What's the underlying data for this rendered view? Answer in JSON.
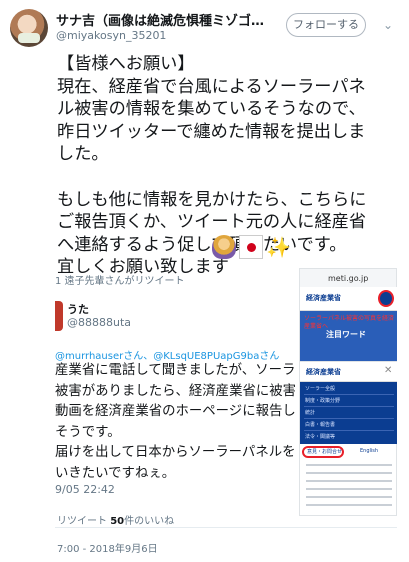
{
  "header": {
    "display_name": "サナ吉（画像は絶滅危惧種ミゾゴイ...",
    "handle": "@miyakosyn_35201",
    "follow_label": "フォローする",
    "caret_icon": "chevron-down-icon"
  },
  "tweet": {
    "text": "【皆様へお願い】\n現在、経産省で台風によるソーラーパネ\nル被害の情報を集めているそうなので、\n昨日ツイッターで纏めた情報を提出しま\nした。\n\nもしも他に情報を見かけたら、こちらに\nご報告頂くか、ツイート元の人に経産省\nへ連絡するよう促して頂きたいです。\n宜しくお願い致します",
    "emojis": [
      "woman-bowing-emoji",
      "japan-flag-emoji",
      "sparkles-emoji"
    ],
    "sparkles_glyph": "✨"
  },
  "quote": {
    "retweet_note": "1 遠子先輩さんがリツイート",
    "name": "うた",
    "handle": "@88888uta",
    "reply_to": "@murrhauserさん、@KLsqUE8PUapG9baさん",
    "body": "産業省に電話して聞きましたが、ソーラー\n被害がありましたら、経済産業省に被害の\n動画を経済産業省のホーページに報告して\nそうです。\n届けを出して日本からソーラーパネルを排\nいきたいですねぇ。",
    "time": "9/05 22:42",
    "phone1": {
      "url": "meti.go.jp",
      "logo": "経済産業省",
      "red_text": "ソーラーパネル被害の写真を経済産業省へ",
      "notice": "注目ワード"
    },
    "phone2": {
      "logo": "経済産業省",
      "close": "✕",
      "menu_items": [
        "ソーラー全般",
        "制度・政策分野",
        "統計",
        "白書・報告書",
        "法令・閣議等"
      ],
      "highlight": "意見・お問合せ",
      "english": "English"
    }
  },
  "footer": {
    "retweets_label": "リツイート",
    "likes_count": "50",
    "likes_label": "件のいいね",
    "timestamp": "7:00 - 2018年9月6日"
  },
  "colors": {
    "link": "#1b95e0",
    "meta": "#657786",
    "meti_blue": "#0b3d91",
    "highlight_red": "#e8202a"
  }
}
